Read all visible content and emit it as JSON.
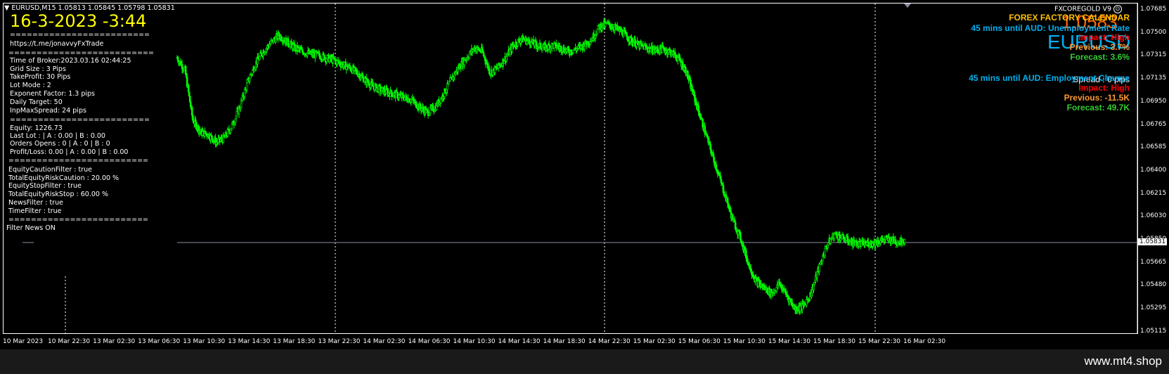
{
  "symbol_header": {
    "symbol": "EURUSD,M15",
    "prices": "1.05813 1.05845 1.05798 1.05831",
    "ea_name": "FXCOREGOLD V9"
  },
  "big_time": "16-3-2023 -3:44",
  "info_panel": [
    "=========================",
    "https://t.me/jonavvyFxTrade",
    "==========================",
    "Time of Broker:2023.03.16 02:44:25",
    "Grid Size : 3 Pips",
    "TakeProfit: 30 Pips",
    "Lot Mode : 2",
    "Exponent Factor: 1.3 pips",
    "Daily Target: 50",
    "InpMaxSpread: 24 pips",
    "=========================",
    "Equity:      1226.73",
    "Last Lot : | A : 0.00 | B : 0.00",
    "Orders Opens :    0  | A : 0 | B : 0",
    "Profit/Loss: 0.00 | A : 0.00 | B : 0.00",
    "=========================",
    "EquityCautionFilter : true",
    "TotalEquityRiskCaution : 20.00 %",
    "EquityStopFilter : true",
    "TotalEquityRiskStop : 60.00 %",
    "NewsFilter : true",
    "TimeFilter : true",
    "=========================",
    "Filter News ON"
  ],
  "news_panel": {
    "title": "FOREX FACTORY CALENDAR",
    "price_overlay": "1.0583",
    "symbol_overlay": "EURUSD",
    "event1": {
      "countdown": "45 mins until AUD: Unemployment Rate",
      "impact": "Impact: High",
      "previous": "Previous: 3.7%",
      "forecast": "Forecast: 3.6%"
    },
    "spread": "Spread : 0 pips",
    "event2": {
      "countdown": "45 mins until AUD: Employment Change",
      "impact": "Impact: High",
      "previous": "Previous: -11.5K",
      "forecast": "Forecast: 49.7K"
    }
  },
  "price_axis": [
    "1.07685",
    "1.07500",
    "1.07315",
    "1.07135",
    "1.06950",
    "1.06765",
    "1.06585",
    "1.06400",
    "1.06215",
    "1.06030",
    "1.05850",
    "1.05665",
    "1.05480",
    "1.05295",
    "1.05115"
  ],
  "current_price_label": "1.05831",
  "time_axis": [
    "10 Mar 2023",
    "10 Mar 22:30",
    "13 Mar 02:30",
    "13 Mar 06:30",
    "13 Mar 10:30",
    "13 Mar 14:30",
    "13 Mar 18:30",
    "13 Mar 22:30",
    "14 Mar 02:30",
    "14 Mar 06:30",
    "14 Mar 10:30",
    "14 Mar 14:30",
    "14 Mar 18:30",
    "14 Mar 22:30",
    "15 Mar 02:30",
    "15 Mar 06:30",
    "15 Mar 10:30",
    "15 Mar 14:30",
    "15 Mar 18:30",
    "15 Mar 22:30",
    "16 Mar 02:30"
  ],
  "price_series": [
    1.073,
    1.072,
    1.068,
    1.067,
    1.0668,
    1.0662,
    1.0665,
    1.0675,
    1.069,
    1.071,
    1.0725,
    1.0735,
    1.0742,
    1.0748,
    1.0743,
    1.0738,
    1.0735,
    1.0733,
    1.0732,
    1.073,
    1.0728,
    1.0725,
    1.0722,
    1.0718,
    1.0712,
    1.0707,
    1.0704,
    1.0702,
    1.07,
    1.0698,
    1.0696,
    1.069,
    1.0686,
    1.069,
    1.07,
    1.0712,
    1.0722,
    1.073,
    1.0738,
    1.0735,
    1.0718,
    1.0722,
    1.073,
    1.074,
    1.0745,
    1.0743,
    1.074,
    1.0738,
    1.074,
    1.0738,
    1.0735,
    1.0737,
    1.074,
    1.0745,
    1.0755,
    1.0757,
    1.0754,
    1.075,
    1.0744,
    1.074,
    1.0738,
    1.0736,
    1.0737,
    1.0735,
    1.073,
    1.072,
    1.07,
    1.068,
    1.066,
    1.064,
    1.062,
    1.06,
    1.0585,
    1.0565,
    1.055,
    1.0545,
    1.054,
    1.0548,
    1.0538,
    1.0528,
    1.053,
    1.054,
    1.056,
    1.0578,
    1.0588,
    1.0585,
    1.0582,
    1.058,
    1.058,
    1.0581,
    1.0583,
    1.0584,
    1.0582,
    1.0583
  ],
  "colors": {
    "background": "#000000",
    "candles": "#00ff00",
    "grid_separator": "#ffffff",
    "price_line": "#8c8fa3",
    "big_time": "#ffff00",
    "news_title": "#ffc000",
    "countdown": "#00b0f0",
    "impact": "#ff0000",
    "previous": "#ff9933",
    "forecast": "#33cc33",
    "price_overlay": "#ff6600",
    "symbol_overlay": "#00b0f0"
  },
  "footer": {
    "site": "www.mt4.shop"
  }
}
